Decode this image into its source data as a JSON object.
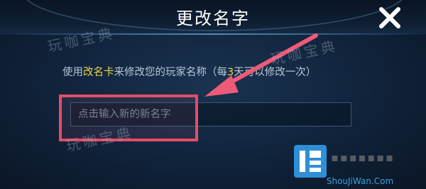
{
  "dialog": {
    "title": "更改名字",
    "close_icon": "close-icon",
    "description": {
      "prefix": "使用",
      "card_name": "改名卡",
      "middle": "来修改您的玩家名称（每",
      "days": "3",
      "suffix": "天可以修改一次）"
    },
    "name_input": {
      "value": "",
      "placeholder": "点击输入新的新名字"
    }
  },
  "watermark": {
    "text": "玩咖宝典"
  },
  "logo": {
    "url_text": "ShouJiWan.Com"
  },
  "colors": {
    "highlight_box": "#e34d67",
    "arrow": "#ef5a77",
    "card_highlight": "#e8d24a",
    "title": "#ffffff"
  }
}
